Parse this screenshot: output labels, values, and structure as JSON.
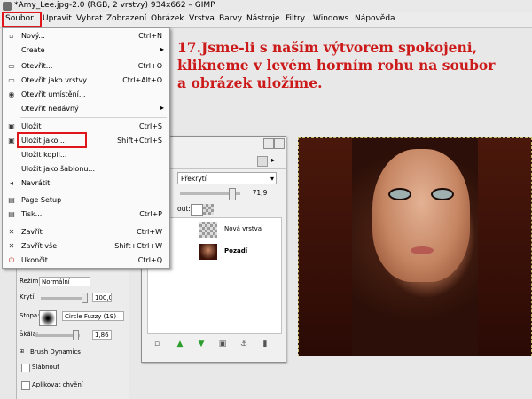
{
  "window": {
    "title": "*Amy_Lee.jpg-2.0 (RGB, 2 vrstvy) 934x662 – GIMP"
  },
  "menubar": [
    "Soubor",
    "Upravit",
    "Vybrat",
    "Zobrazení",
    "Obrázek",
    "Vrstva",
    "Barvy",
    "Nástroje",
    "Filtry",
    "Windows",
    "Nápověda"
  ],
  "instruction": {
    "line1": "17.Jsme-li s naším výtvorem spokojeni,",
    "line2": "klikneme v levém horním rohu na soubor",
    "line3": "a obrázek uložíme."
  },
  "file_menu": {
    "items": [
      {
        "label": "Nový...",
        "shortcut": "Ctrl+N",
        "icon": "new-document-icon"
      },
      {
        "label": "Create",
        "shortcut": "",
        "icon": "",
        "submenu": true
      },
      {
        "label": "Otevřít...",
        "shortcut": "Ctrl+O",
        "icon": "open-folder-icon"
      },
      {
        "label": "Otevřít jako vrstvy...",
        "shortcut": "Ctrl+Alt+O",
        "icon": "open-layers-icon"
      },
      {
        "label": "Otevřít umístění...",
        "shortcut": "",
        "icon": "open-location-icon"
      },
      {
        "label": "Otevřít nedávný",
        "shortcut": "",
        "icon": "",
        "submenu": true
      },
      {
        "label": "Uložit",
        "shortcut": "Ctrl+S",
        "icon": "save-icon"
      },
      {
        "label": "Uložit jako...",
        "shortcut": "Shift+Ctrl+S",
        "icon": "save-as-icon"
      },
      {
        "label": "Uložit kopii...",
        "shortcut": "",
        "icon": ""
      },
      {
        "label": "Uložit jako šablonu...",
        "shortcut": "",
        "icon": ""
      },
      {
        "label": "Navrátit",
        "shortcut": "",
        "icon": "revert-icon"
      },
      {
        "label": "Page Setup",
        "shortcut": "",
        "icon": "page-setup-icon"
      },
      {
        "label": "Tisk...",
        "shortcut": "Ctrl+P",
        "icon": "print-icon"
      },
      {
        "label": "Zavřít",
        "shortcut": "Ctrl+W",
        "icon": "close-icon"
      },
      {
        "label": "Zavřít vše",
        "shortcut": "Shift+Ctrl+W",
        "icon": "close-all-icon"
      },
      {
        "label": "Ukončit",
        "shortcut": "Ctrl+Q",
        "icon": "quit-icon"
      }
    ]
  },
  "layers_dialog": {
    "mode": "Překrytí",
    "opacity": "71,9",
    "opacity_fraction": 0.719,
    "lock_label": "out:",
    "layers": [
      {
        "name": "Nová vrstva",
        "selected": false
      },
      {
        "name": "Pozadí",
        "selected": true
      }
    ]
  },
  "tool_options": {
    "mode_label": "Režim:",
    "mode_value": "Normální",
    "opacity_label": "Krytí:",
    "opacity_value": "100,0",
    "brush_label": "Stopa:",
    "brush_value": "Circle Fuzzy (19)",
    "scale_label": "Škála:",
    "scale_value": "1,86",
    "dynamics_label": "Brush Dynamics",
    "fade_label": "Slábnout",
    "jitter_label": "Aplikovat chvění"
  },
  "colors": {
    "highlight": "#e0161b",
    "instruction_text": "#cc1a1a"
  }
}
